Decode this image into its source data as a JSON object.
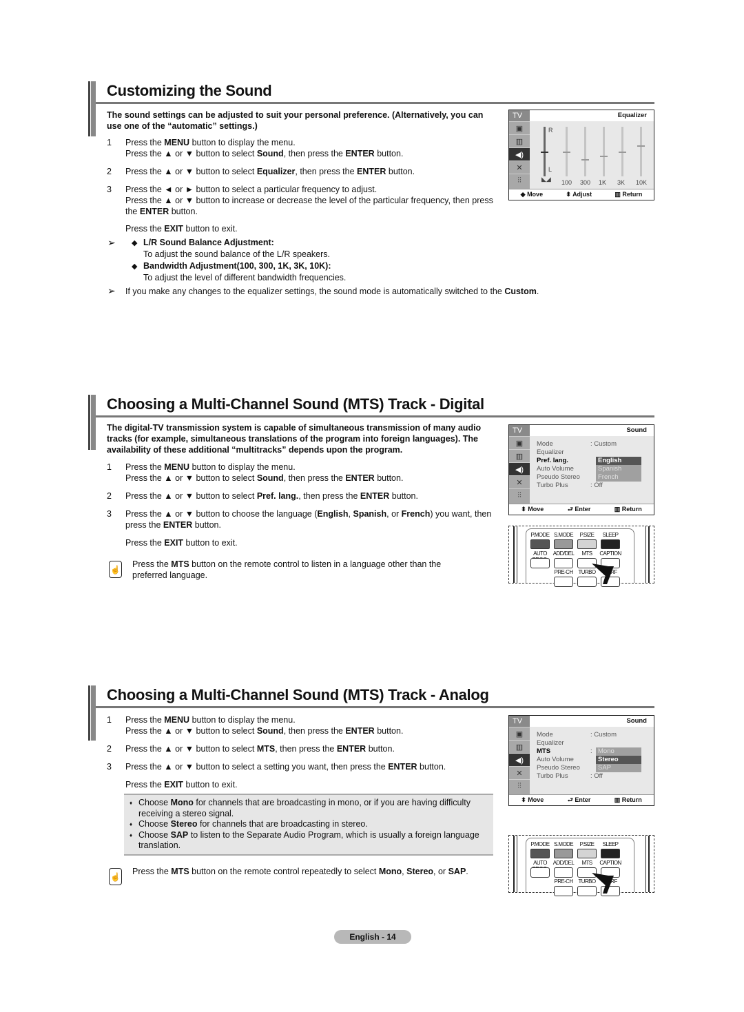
{
  "sections": [
    {
      "title": "Customizing the Sound",
      "intro": "The sound settings can be adjusted to suit your personal preference. (Alternatively, you can use one of the “automatic” settings.)",
      "steps": [
        {
          "num": "1",
          "lines": [
            "Press the <b>MENU</b> button to display the menu.",
            "Press the ▲ or ▼ button to select <b>Sound</b>, then press the <b>ENTER</b> button."
          ]
        },
        {
          "num": "2",
          "lines": [
            "Press the ▲ or ▼ button to select <b>Equalizer</b>, then press the <b>ENTER</b> button."
          ]
        },
        {
          "num": "3",
          "lines": [
            "Press the ◄ or ► button to select a particular frequency to adjust.",
            "Press the ▲ or ▼ button to increase or decrease the level of the particular frequency, then press the <b>ENTER</b> button."
          ]
        }
      ],
      "exit": "Press the <b>EXIT</b> button to exit.",
      "notes": [
        {
          "heading": "L/R Sound Balance Adjustment:",
          "text": "To adjust the sound balance of the L/R speakers."
        },
        {
          "heading": "Bandwidth Adjustment(100, 300, 1K, 3K, 10K):",
          "text": "To adjust the level of different bandwidth frequencies."
        }
      ],
      "footnote": "If you make any changes to the equalizer settings, the sound mode is automatically switched to the <b>Custom</b>."
    },
    {
      "title": "Choosing a Multi-Channel Sound (MTS) Track - Digital",
      "intro": "The digital-TV transmission system is capable of simultaneous transmission of many audio tracks (for example, simultaneous translations of the program into foreign languages). The availability of these additional “multitracks” depends upon the program.",
      "steps": [
        {
          "num": "1",
          "lines": [
            "Press the <b>MENU</b> button to display the menu.",
            "Press the ▲ or ▼ button to select <b>Sound</b>, then press the <b>ENTER</b> button."
          ]
        },
        {
          "num": "2",
          "lines": [
            "Press the ▲ or ▼ button to select <b>Pref. lang.</b>, then press the <b>ENTER</b> button."
          ]
        },
        {
          "num": "3",
          "lines": [
            "Press the ▲ or ▼ button to choose the language (<b>English</b>, <b>Spanish</b>, or <b>French</b>) you want, then press the <b>ENTER</b> button."
          ]
        }
      ],
      "exit": "Press the <b>EXIT</b> button to exit.",
      "remote_tip": "Press the <b>MTS</b> button on the remote control to listen in a language other than the preferred language."
    },
    {
      "title": "Choosing a Multi-Channel Sound (MTS) Track - Analog",
      "steps": [
        {
          "num": "1",
          "lines": [
            "Press the <b>MENU</b> button to display the menu.",
            "Press the ▲ or ▼ button to select <b>Sound</b>, then press the <b>ENTER</b> button."
          ]
        },
        {
          "num": "2",
          "lines": [
            "Press the ▲ or ▼ button to select <b>MTS</b>, then press the <b>ENTER</b> button."
          ]
        },
        {
          "num": "3",
          "lines": [
            "Press the ▲ or ▼ button to select a setting you want, then press the <b>ENTER</b> button."
          ]
        }
      ],
      "exit": "Press the <b>EXIT</b> button to exit.",
      "options": [
        "Choose <b>Mono</b> for channels that are broadcasting in mono, or if you are having difficulty receiving a stereo signal.",
        "Choose <b>Stereo</b> for channels that are broadcasting in stereo.",
        "Choose <b>SAP</b> to listen to the Separate Audio Program, which is usually a foreign language translation."
      ],
      "remote_tip": "Press the <b>MTS</b> button on the remote control repeatedly to select <b>Mono</b>, <b>Stereo</b>, or <b>SAP</b>."
    }
  ],
  "osd": {
    "tv_label": "TV",
    "side_icons": [
      "picture-icon",
      "channel-icon",
      "sound-icon",
      "setup-icon",
      "input-icon"
    ],
    "equalizer": {
      "title": "Equalizer",
      "balance_top": "R",
      "balance_bottom": "L",
      "balance_icon": "balance-icon",
      "bands": [
        "100",
        "300",
        "1K",
        "3K",
        "10K"
      ],
      "levels_pct": {
        "balance": 50,
        "100": 50,
        "300": 35,
        "1K": 42,
        "3K": 50,
        "10K": 62
      },
      "footer": {
        "move": "Move",
        "adjust": "Adjust",
        "return": "Return"
      }
    },
    "sound_digital": {
      "title": "Sound",
      "rows": [
        {
          "label": "Mode",
          "value": ": Custom"
        },
        {
          "label": "Equalizer",
          "value": ""
        },
        {
          "label": "Pref. lang.",
          "value": ""
        },
        {
          "label": "Auto Volume",
          "value": ""
        },
        {
          "label": "Pseudo Stereo",
          "value": ""
        },
        {
          "label": "Turbo Plus",
          "value": ": Off"
        }
      ],
      "options": [
        "English",
        "Spanish",
        "French"
      ],
      "selected_option": "English",
      "footer": {
        "move": "Move",
        "enter": "Enter",
        "return": "Return"
      }
    },
    "sound_analog": {
      "title": "Sound",
      "rows": [
        {
          "label": "Mode",
          "value": ": Custom"
        },
        {
          "label": "Equalizer",
          "value": ""
        },
        {
          "label": "MTS",
          "value": ":"
        },
        {
          "label": "Auto Volume",
          "value": ""
        },
        {
          "label": "Pseudo Stereo",
          "value": ""
        },
        {
          "label": "Turbo Plus",
          "value": ": Off"
        }
      ],
      "options": [
        "Mono",
        "Stereo",
        "SAP"
      ],
      "selected_option": "Stereo",
      "footer": {
        "move": "Move",
        "enter": "Enter",
        "return": "Return"
      }
    }
  },
  "remote": {
    "row1": [
      "P.MODE",
      "S.MODE",
      "P.SIZE",
      "SLEEP"
    ],
    "row1_colors": [
      "#555555",
      "#999999",
      "#d4d4d4",
      "#222222"
    ],
    "row2": [
      "AUTO PROG.",
      "ADD/DEL",
      "MTS",
      "CAPTION"
    ],
    "row3": [
      "PRE-CH",
      "TURBO",
      "SURF"
    ]
  },
  "footer": {
    "page_label": "English - 14"
  }
}
